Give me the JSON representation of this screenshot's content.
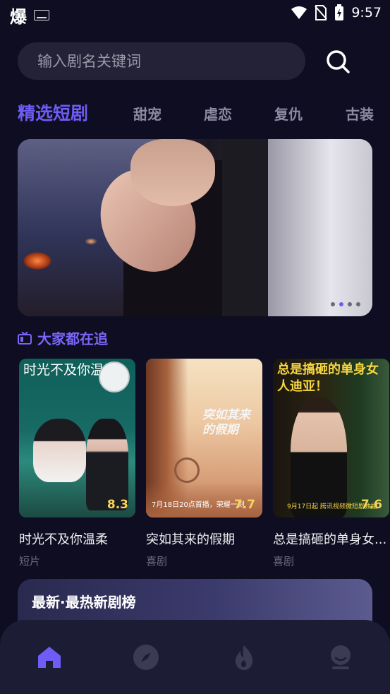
{
  "status_bar": {
    "app_glyph": "爆",
    "time": "9:57"
  },
  "search": {
    "placeholder": "输入剧名关键词"
  },
  "tabs": [
    {
      "label": "精选短剧",
      "active": true
    },
    {
      "label": "甜宠"
    },
    {
      "label": "虐恋"
    },
    {
      "label": "复仇"
    },
    {
      "label": "古装"
    }
  ],
  "banner": {
    "pages": 4,
    "current_page": 2
  },
  "section": {
    "title": "大家都在追"
  },
  "dramas": [
    {
      "poster_text": "时光不及你温柔",
      "score": "8.3",
      "title": "时光不及你温柔",
      "genre": "短片"
    },
    {
      "poster_text": "突如其来的假期",
      "poster_meta": "7月18日20点首播，荣耀一刻",
      "score": "7.7",
      "title": "突如其来的假期",
      "genre": "喜剧"
    },
    {
      "poster_text": "总是搞砸的单身女人迪亚！",
      "poster_meta": "9月17日起 腾讯视频微短剧独播",
      "score": "7.6",
      "title": "总是搞砸的单身女...",
      "genre": "喜剧"
    }
  ],
  "rank": {
    "title": "最新·最热新剧榜"
  },
  "nav": [
    {
      "icon": "home-icon",
      "active": true
    },
    {
      "icon": "compass-icon"
    },
    {
      "icon": "fire-icon"
    },
    {
      "icon": "profile-icon"
    }
  ],
  "colors": {
    "accent": "#6f5cf5",
    "background": "#0e0d21",
    "score": "#f5d55a"
  }
}
